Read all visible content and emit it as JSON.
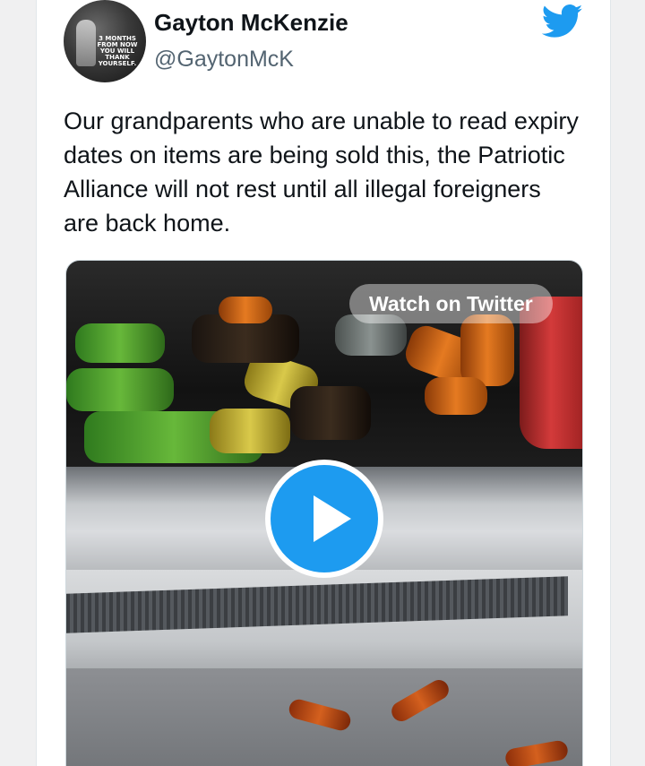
{
  "tweet": {
    "author": {
      "name": "Gayton McKenzie",
      "handle": "@GaytonMcK",
      "avatar_text": "3 MONTHS\nFROM NOW\nYOU WILL\nTHANK\nYOURSELF."
    },
    "text": "Our grandparents who are unable to read expiry dates on items are being sold this, the Patriotic Alliance will not rest until all illegal foreigners are back home.",
    "media": {
      "watch_label": "Watch on Twitter",
      "play_icon": "play-icon"
    },
    "logo_icon": "twitter-bird-icon"
  },
  "colors": {
    "twitter_blue": "#1d9bf0",
    "text": "#0f1419",
    "handle": "#536471"
  }
}
